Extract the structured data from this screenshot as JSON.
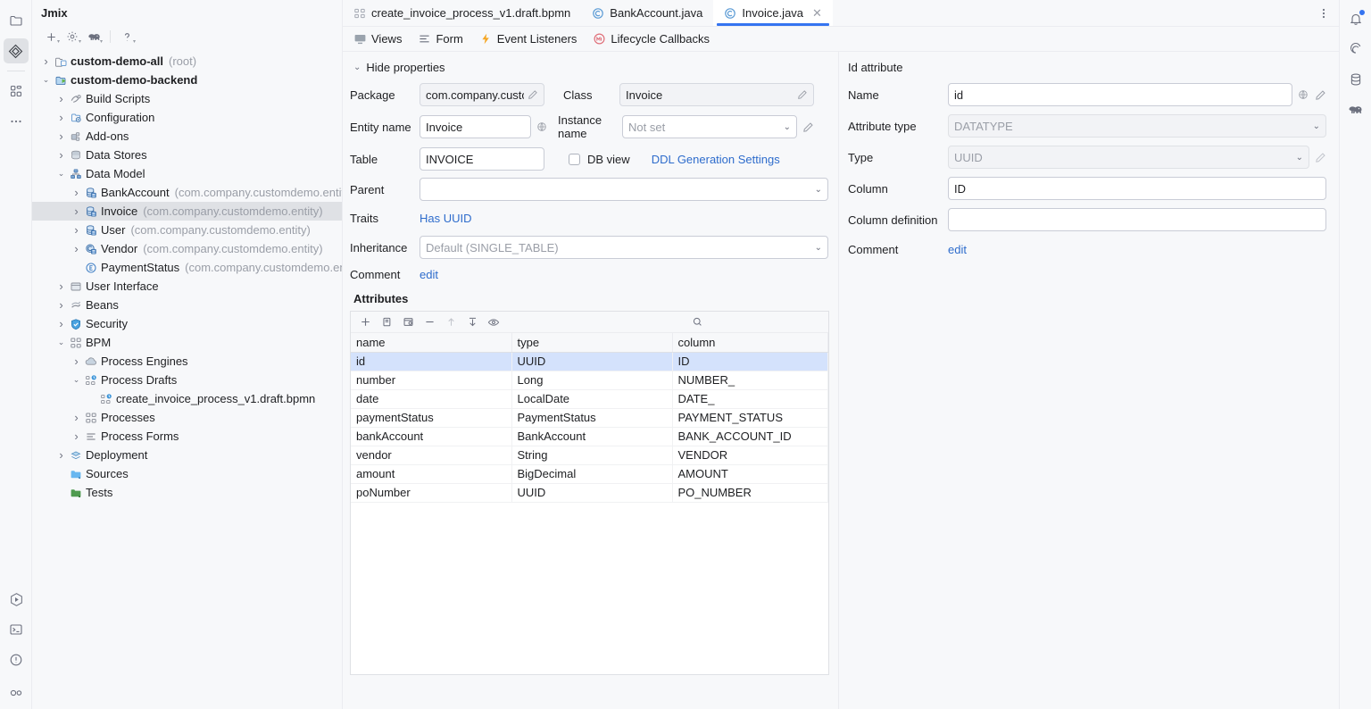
{
  "left_rail": {
    "items": [
      {
        "name": "project-files-icon",
        "label": "Project Files"
      },
      {
        "name": "jmix-icon",
        "label": "Jmix"
      },
      {
        "name": "structure-icon",
        "label": "Structure"
      },
      {
        "name": "more-tool-windows-icon",
        "label": "More Tool Windows"
      }
    ],
    "bottom_items": [
      {
        "name": "run-icon",
        "label": "Run"
      },
      {
        "name": "terminal-icon",
        "label": "Terminal"
      },
      {
        "name": "problems-icon",
        "label": "Problems"
      },
      {
        "name": "services-icon",
        "label": "Services"
      }
    ]
  },
  "project_pane": {
    "title": "Jmix",
    "toolbar": [
      {
        "name": "add-icon",
        "label": "New"
      },
      {
        "name": "settings-icon",
        "label": "Settings"
      },
      {
        "name": "gradle-elephant-icon",
        "label": "Gradle"
      },
      {
        "name": "help-icon",
        "label": "Help"
      }
    ],
    "tree": [
      {
        "indent": 0,
        "twist": "collapsed",
        "icon": "module-root-icon",
        "label": "custom-demo-all",
        "bold": true,
        "suffix": "(root)",
        "selected": false
      },
      {
        "indent": 0,
        "twist": "expanded",
        "icon": "module-run-icon",
        "label": "custom-demo-backend",
        "bold": true,
        "suffix": "",
        "selected": false
      },
      {
        "indent": 1,
        "twist": "collapsed",
        "icon": "build-scripts-icon",
        "label": "Build Scripts",
        "bold": false,
        "suffix": "",
        "selected": false
      },
      {
        "indent": 1,
        "twist": "collapsed",
        "icon": "configuration-icon",
        "label": "Configuration",
        "bold": false,
        "suffix": "",
        "selected": false
      },
      {
        "indent": 1,
        "twist": "collapsed",
        "icon": "addons-icon",
        "label": "Add-ons",
        "bold": false,
        "suffix": "",
        "selected": false
      },
      {
        "indent": 1,
        "twist": "collapsed",
        "icon": "data-stores-icon",
        "label": "Data Stores",
        "bold": false,
        "suffix": "",
        "selected": false
      },
      {
        "indent": 1,
        "twist": "expanded",
        "icon": "data-model-icon",
        "label": "Data Model",
        "bold": false,
        "suffix": "",
        "selected": false
      },
      {
        "indent": 2,
        "twist": "collapsed",
        "icon": "entity-icon",
        "label": "BankAccount",
        "bold": false,
        "suffix": "(com.company.customdemo.entity)",
        "selected": false
      },
      {
        "indent": 2,
        "twist": "collapsed",
        "icon": "entity-icon",
        "label": "Invoice",
        "bold": false,
        "suffix": "(com.company.customdemo.entity)",
        "selected": true
      },
      {
        "indent": 2,
        "twist": "collapsed",
        "icon": "entity-icon",
        "label": "User",
        "bold": false,
        "suffix": "(com.company.customdemo.entity)",
        "selected": false
      },
      {
        "indent": 2,
        "twist": "collapsed",
        "icon": "entity-class-icon",
        "label": "Vendor",
        "bold": false,
        "suffix": "(com.company.customdemo.entity)",
        "selected": false
      },
      {
        "indent": 2,
        "twist": "none",
        "icon": "enum-icon",
        "label": "PaymentStatus",
        "bold": false,
        "suffix": "(com.company.customdemo.ent",
        "selected": false
      },
      {
        "indent": 1,
        "twist": "collapsed",
        "icon": "user-interface-icon",
        "label": "User Interface",
        "bold": false,
        "suffix": "",
        "selected": false
      },
      {
        "indent": 1,
        "twist": "collapsed",
        "icon": "beans-icon",
        "label": "Beans",
        "bold": false,
        "suffix": "",
        "selected": false
      },
      {
        "indent": 1,
        "twist": "collapsed",
        "icon": "security-shield-icon",
        "label": "Security",
        "bold": false,
        "suffix": "",
        "selected": false
      },
      {
        "indent": 1,
        "twist": "expanded",
        "icon": "bpm-icon",
        "label": "BPM",
        "bold": false,
        "suffix": "",
        "selected": false
      },
      {
        "indent": 2,
        "twist": "collapsed",
        "icon": "process-engines-icon",
        "label": "Process Engines",
        "bold": false,
        "suffix": "",
        "selected": false
      },
      {
        "indent": 2,
        "twist": "expanded",
        "icon": "process-drafts-icon",
        "label": "Process Drafts",
        "bold": false,
        "suffix": "",
        "selected": false
      },
      {
        "indent": 3,
        "twist": "none",
        "icon": "bpmn-draft-icon",
        "label": "create_invoice_process_v1.draft.bpmn",
        "bold": false,
        "suffix": "",
        "selected": false
      },
      {
        "indent": 2,
        "twist": "collapsed",
        "icon": "processes-icon",
        "label": "Processes",
        "bold": false,
        "suffix": "",
        "selected": false
      },
      {
        "indent": 2,
        "twist": "collapsed",
        "icon": "process-forms-icon",
        "label": "Process Forms",
        "bold": false,
        "suffix": "",
        "selected": false
      },
      {
        "indent": 1,
        "twist": "collapsed",
        "icon": "deployment-icon",
        "label": "Deployment",
        "bold": false,
        "suffix": "",
        "selected": false
      },
      {
        "indent": 1,
        "twist": "none",
        "icon": "sources-folder-icon",
        "label": "Sources",
        "bold": false,
        "suffix": "",
        "selected": false
      },
      {
        "indent": 1,
        "twist": "none",
        "icon": "tests-folder-icon",
        "label": "Tests",
        "bold": false,
        "suffix": "",
        "selected": false
      }
    ]
  },
  "editor_tabs": [
    {
      "label": "create_invoice_process_v1.draft.bpmn",
      "icon": "bpmn-icon",
      "active": false,
      "closable": false
    },
    {
      "label": "BankAccount.java",
      "icon": "java-class-icon",
      "active": false,
      "closable": false
    },
    {
      "label": "Invoice.java",
      "icon": "java-class-icon",
      "active": true,
      "closable": true
    }
  ],
  "designer_tabs": [
    {
      "label": "Views",
      "icon": "views-icon"
    },
    {
      "label": "Form",
      "icon": "form-icon"
    },
    {
      "label": "Event Listeners",
      "icon": "event-listeners-icon"
    },
    {
      "label": "Lifecycle Callbacks",
      "icon": "lifecycle-callbacks-icon"
    }
  ],
  "entity_form": {
    "hide_properties_label": "Hide properties",
    "package": {
      "label": "Package",
      "value": "com.company.custo"
    },
    "class": {
      "label": "Class",
      "value": "Invoice"
    },
    "entity_name": {
      "label": "Entity name",
      "value": "Invoice"
    },
    "instance_name": {
      "label": "Instance name",
      "value": "Not set"
    },
    "table": {
      "label": "Table",
      "value": "INVOICE"
    },
    "db_view": {
      "label": "DB view",
      "checked": false
    },
    "ddl_link": "DDL Generation Settings",
    "parent": {
      "label": "Parent",
      "value": ""
    },
    "traits": {
      "label": "Traits",
      "value": "Has UUID"
    },
    "inheritance": {
      "label": "Inheritance",
      "value": "Default (SINGLE_TABLE)"
    },
    "comment": {
      "label": "Comment",
      "value": "edit"
    }
  },
  "attributes": {
    "section_title": "Attributes",
    "toolbar": [
      {
        "name": "add-attribute-icon",
        "dim": false
      },
      {
        "name": "copy-attribute-icon",
        "dim": false
      },
      {
        "name": "generate-attribute-icon",
        "dim": false
      },
      {
        "name": "remove-attribute-icon",
        "dim": false
      },
      {
        "name": "move-up-icon",
        "dim": true
      },
      {
        "name": "move-down-icon",
        "dim": false
      },
      {
        "name": "preview-eye-icon",
        "dim": false
      }
    ],
    "search_placeholder": "",
    "columns": [
      "name",
      "type",
      "column"
    ],
    "rows": [
      {
        "name": "id",
        "type": "UUID",
        "column": "ID",
        "selected": true
      },
      {
        "name": "number",
        "type": "Long",
        "column": "NUMBER_",
        "selected": false
      },
      {
        "name": "date",
        "type": "LocalDate",
        "column": "DATE_",
        "selected": false
      },
      {
        "name": "paymentStatus",
        "type": "PaymentStatus",
        "column": "PAYMENT_STATUS",
        "selected": false
      },
      {
        "name": "bankAccount",
        "type": "BankAccount",
        "column": "BANK_ACCOUNT_ID",
        "selected": false
      },
      {
        "name": "vendor",
        "type": "String",
        "column": "VENDOR",
        "selected": false
      },
      {
        "name": "amount",
        "type": "BigDecimal",
        "column": "AMOUNT",
        "selected": false
      },
      {
        "name": "poNumber",
        "type": "UUID",
        "column": "PO_NUMBER",
        "selected": false
      }
    ]
  },
  "id_attribute": {
    "title": "Id attribute",
    "name": {
      "label": "Name",
      "value": "id"
    },
    "attribute_type": {
      "label": "Attribute type",
      "value": "DATATYPE"
    },
    "type": {
      "label": "Type",
      "value": "UUID"
    },
    "column": {
      "label": "Column",
      "value": "ID"
    },
    "column_definition": {
      "label": "Column definition",
      "value": ""
    },
    "comment": {
      "label": "Comment",
      "value": "edit"
    }
  },
  "right_rail": {
    "items": [
      {
        "name": "notifications-bell-icon",
        "badge": true
      },
      {
        "name": "ai-assistant-icon",
        "badge": false
      },
      {
        "name": "database-icon",
        "badge": false
      },
      {
        "name": "gradle-icon",
        "badge": false
      }
    ]
  },
  "colors": {
    "accent": "#3574f0",
    "link": "#2e6ccc",
    "selection": "#d4e2fc",
    "tree_selection": "#dfe1e5",
    "panel_bg": "#f7f8fa",
    "border": "#dfe1e5"
  }
}
